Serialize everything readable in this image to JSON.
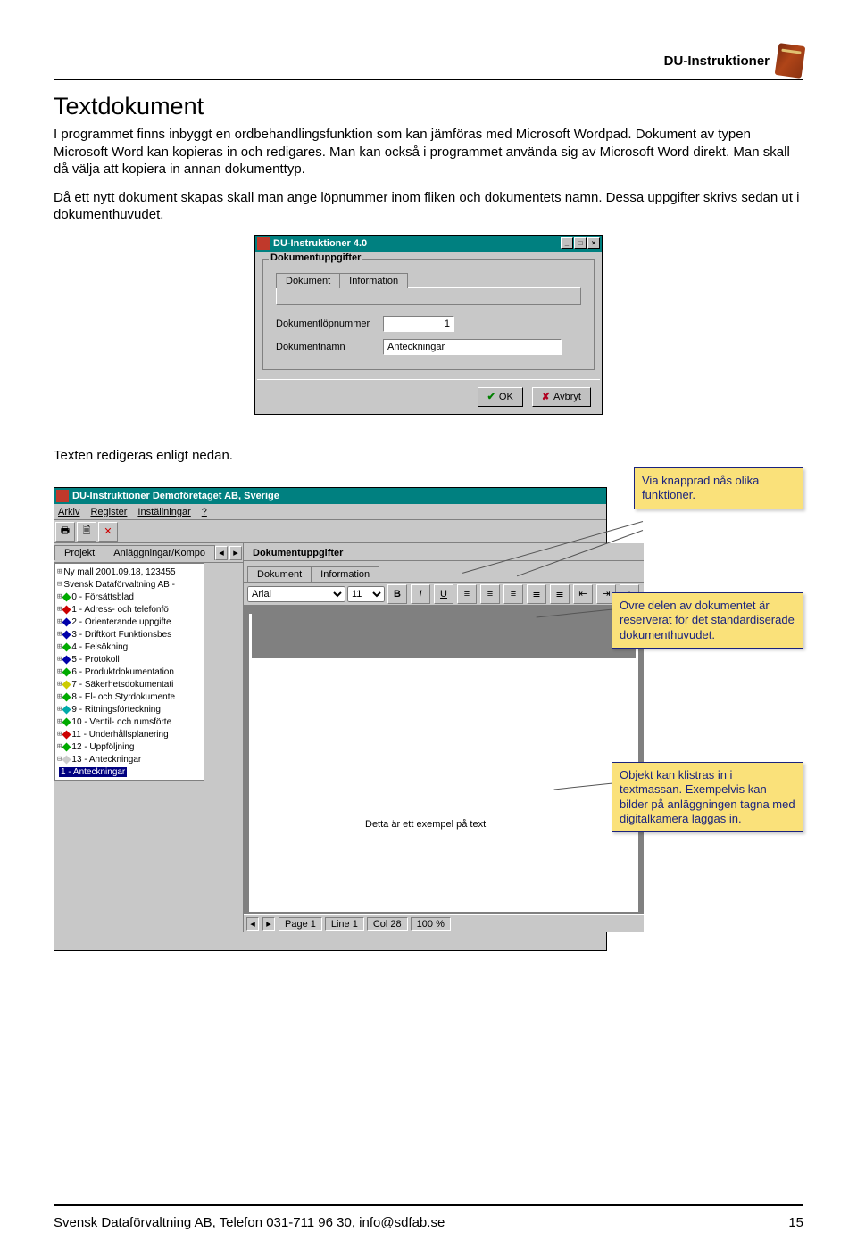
{
  "header": {
    "title": "DU-Instruktioner"
  },
  "h1": "Textdokument",
  "para1": "I programmet finns inbyggt en ordbehandlingsfunktion som kan jämföras med Microsoft Wordpad. Dokument av typen Microsoft Word kan kopieras in och redigares. Man kan också i programmet använda sig av Microsoft Word direkt. Man skall då välja att kopiera in annan dokumenttyp.",
  "para2": "Då ett nytt dokument skapas skall man ange löpnummer inom fliken och dokumentets namn. Dessa uppgifter skrivs sedan ut i dokumenthuvudet.",
  "dlg1": {
    "title": "DU-Instruktioner 4.0",
    "group": "Dokumentuppgifter",
    "tabs": [
      "Dokument",
      "Information"
    ],
    "lbl_num": "Dokumentlöpnummer",
    "val_num": "1",
    "lbl_name": "Dokumentnamn",
    "val_name": "Anteckningar",
    "ok": "OK",
    "cancel": "Avbryt"
  },
  "edit_text": "Texten redigeras enligt nedan.",
  "callouts": {
    "c1": "Via knapprad nås olika funktioner.",
    "c2": "Övre delen av dokumentet är reserverat för det standardiserade dokumenthuvudet.",
    "c3": "Objekt kan klistras in i textmassan. Exempelvis kan bilder på anläggningen tagna med digitalkamera läggas in."
  },
  "editor": {
    "title": "DU-Instruktioner Demoföretaget AB, Sverige",
    "menus": [
      "Arkiv",
      "Register",
      "Inställningar",
      "?"
    ],
    "nav_left": "Projekt",
    "nav_right": "Anläggningar/Kompo",
    "grp": "Dokumentuppgifter",
    "tabs": [
      "Dokument",
      "Information"
    ],
    "font": "Arial",
    "size": "11",
    "doctext": "Detta är ett exempel på text",
    "status": {
      "page": "Page  1",
      "line": "Line  1",
      "col": "Col  28",
      "zoom": "100 %"
    }
  },
  "tree": [
    {
      "pre": "⊞",
      "icon": "",
      "label": "Ny mall 2001.09.18, 123455"
    },
    {
      "pre": "⊟",
      "icon": "",
      "label": "Svensk Dataförvaltning AB -"
    },
    {
      "pre": "  ⊞",
      "icon": "d-g",
      "label": "0 - Försättsblad"
    },
    {
      "pre": "  ⊞",
      "icon": "d-r",
      "label": "1 - Adress- och telefonfö"
    },
    {
      "pre": "  ⊞",
      "icon": "d-b",
      "label": "2 - Orienterande uppgifte"
    },
    {
      "pre": "  ⊞",
      "icon": "d-b",
      "label": "3 - Driftkort Funktionsbes"
    },
    {
      "pre": "  ⊞",
      "icon": "d-g",
      "label": "4 - Felsökning"
    },
    {
      "pre": "  ⊞",
      "icon": "d-b",
      "label": "5 - Protokoll"
    },
    {
      "pre": "  ⊞",
      "icon": "d-g",
      "label": "6 - Produktdokumentation"
    },
    {
      "pre": "  ⊞",
      "icon": "d-y",
      "label": "7 - Säkerhetsdokumentati"
    },
    {
      "pre": "  ⊞",
      "icon": "d-g",
      "label": "8 - El- och Styrdokumente"
    },
    {
      "pre": "  ⊞",
      "icon": "d-c",
      "label": "9 - Ritningsförteckning"
    },
    {
      "pre": "  ⊞",
      "icon": "d-g",
      "label": "10 - Ventil- och rumsförte"
    },
    {
      "pre": "  ⊞",
      "icon": "d-r",
      "label": "11 - Underhållsplanering"
    },
    {
      "pre": "  ⊞",
      "icon": "d-g",
      "label": "12 - Uppföljning"
    },
    {
      "pre": "  ⊟",
      "icon": "d-w",
      "label": "13 - Anteckningar"
    },
    {
      "pre": "      ",
      "icon": "",
      "label": "1 - Anteckningar",
      "sel": true
    }
  ],
  "footer": {
    "org": "Svensk Dataförvaltning AB, Telefon 031-711 96 30, info@sdfab.se",
    "page": "15"
  }
}
